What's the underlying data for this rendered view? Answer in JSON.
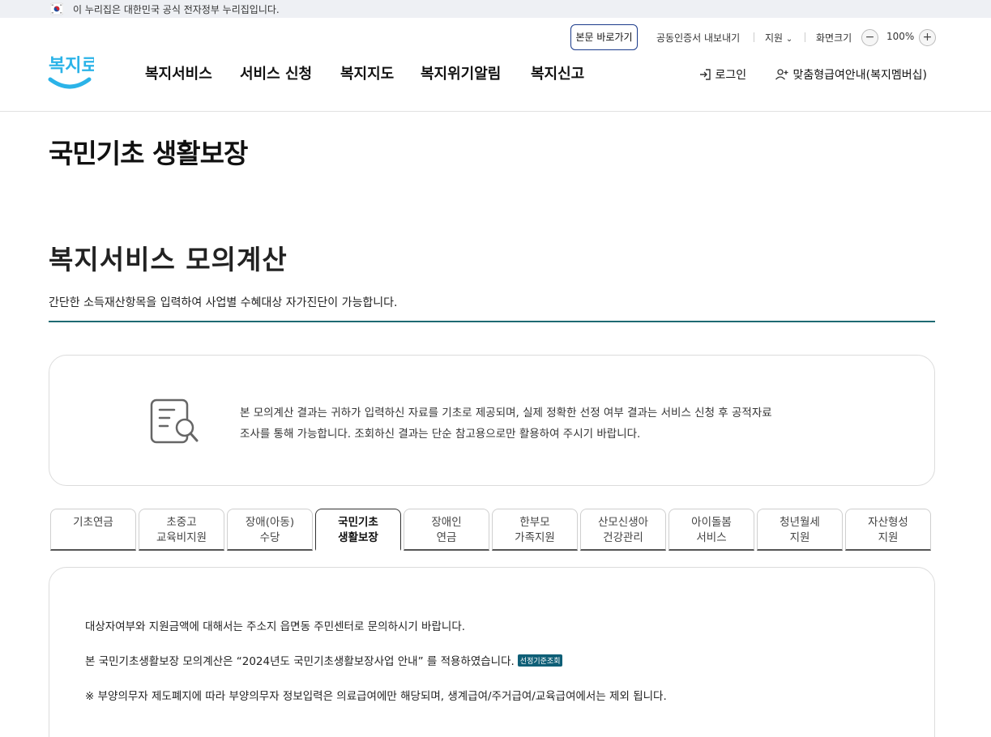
{
  "gov_banner": {
    "text": "이 누리집은 대한민국 공식 전자정부 누리집입니다."
  },
  "utility": {
    "skip_link": "본문 바로가기",
    "cert_export": "공동인증서 내보내기",
    "support": "지원",
    "screen_size": "화면크기",
    "zoom_out": "−",
    "zoom_level": "100%",
    "zoom_in": "+"
  },
  "header": {
    "logo_text": "복지로",
    "nav": [
      "복지서비스",
      "서비스 신청",
      "복지지도",
      "복지위기알림",
      "복지신고"
    ],
    "login": "로그인",
    "membership": "맞춤형급여안내(복지멤버십)"
  },
  "page": {
    "title": "국민기초 생활보장"
  },
  "section": {
    "title": "복지서비스 모의계산",
    "description": "간단한 소득재산항목을 입력하여 사업별 수혜대상 자가진단이 가능합니다."
  },
  "notice": {
    "line1": "본 모의계산 결과는 귀하가 입력하신 자료를 기초로 제공되며, 실제 정확한 선정 여부 결과는 서비스 신청 후 공적자료",
    "line2": "조사를 통해 가능합니다. 조회하신 결과는 단순 참고용으로만 활용하여 주시기 바랍니다."
  },
  "tabs": [
    {
      "line1": "기초연금",
      "line2": ""
    },
    {
      "line1": "초중고",
      "line2": "교육비지원"
    },
    {
      "line1": "장애(아동)",
      "line2": "수당"
    },
    {
      "line1": "국민기초",
      "line2": "생활보장"
    },
    {
      "line1": "장애인",
      "line2": "연금"
    },
    {
      "line1": "한부모",
      "line2": "가족지원"
    },
    {
      "line1": "산모신생아",
      "line2": "건강관리"
    },
    {
      "line1": "아이돌봄",
      "line2": "서비스"
    },
    {
      "line1": "청년월세",
      "line2": "지원"
    },
    {
      "line1": "자산형성",
      "line2": "지원"
    }
  ],
  "active_tab": "국민기초 생활보장",
  "content": {
    "line1": "대상자여부와 지원금액에 대해서는 주소지 읍면동 주민센터로 문의하시기 바랍니다.",
    "line2": "본 국민기초생활보장 모의계산은 “2024년도 국민기초생활보장사업 안내” 를 적용하였습니다.",
    "criteria_button": "선정기준조회",
    "line3": "※ 부양의무자 제도폐지에 따라 부양의무자 정보입력은 의료급여에만 해당되며, 생계급여/주거급여/교육급여에서는 제외 됩니다."
  },
  "colors": {
    "accent": "#1f6a73",
    "badge": "#0f5f77",
    "skip_border": "#1b3b8b"
  }
}
